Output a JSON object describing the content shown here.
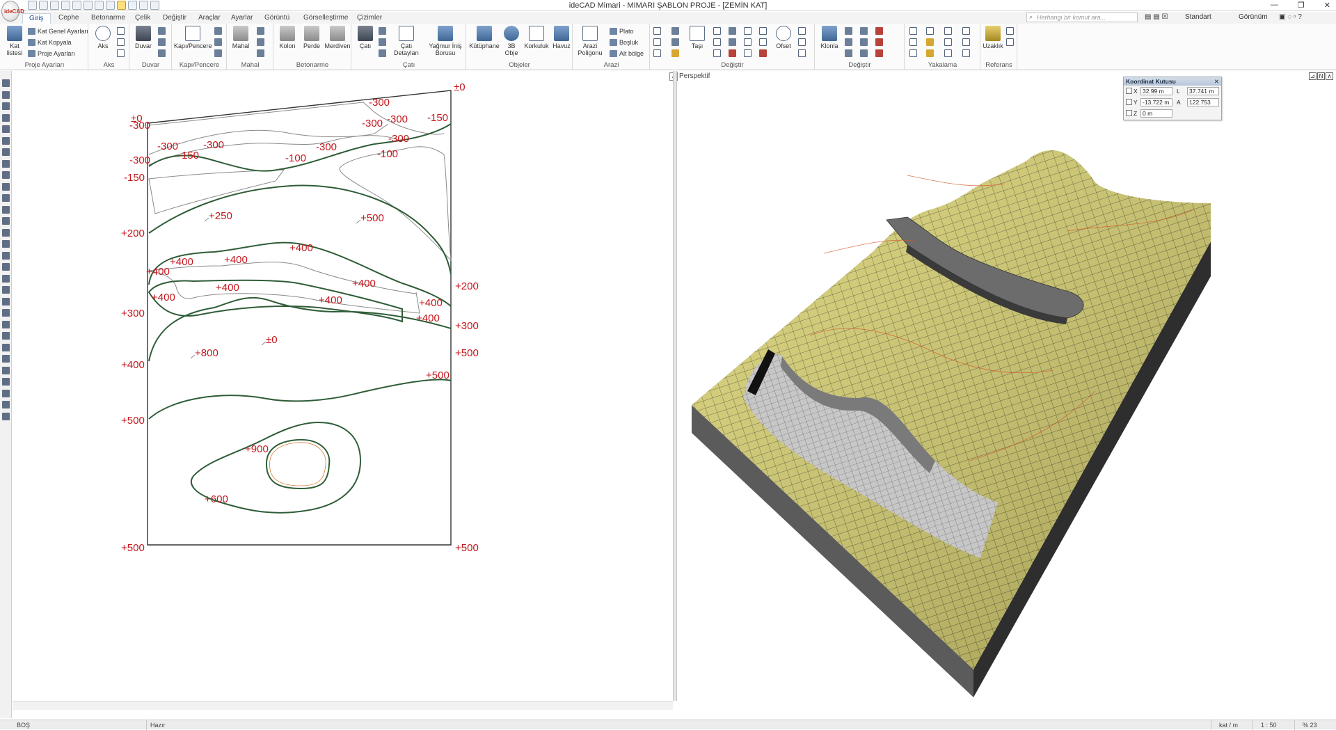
{
  "window": {
    "title": "ideCAD Mimari - MIMARI ŞABLON PROJE - [ZEMİN KAT]",
    "logo_text": "ideCAD",
    "controls": [
      "—",
      "❐",
      "✕"
    ]
  },
  "tabs": [
    "Giriş",
    "Cephe",
    "Betonarme",
    "Çelik",
    "Değiştir",
    "Araçlar",
    "Ayarlar",
    "Görüntü",
    "Görselleştirme",
    "Çizimler"
  ],
  "search": {
    "placeholder": "Herhangi bir komut ara..."
  },
  "topright": {
    "style": "Standart",
    "view": "Görünüm"
  },
  "ribbon": {
    "proje": {
      "label": "Proje Ayarları",
      "kat_listesi": "Kat listesi",
      "items": [
        "Kat Genel Ayarları",
        "Kat Kopyala",
        "Proje Ayarları"
      ]
    },
    "aks": {
      "label": "Aks",
      "btn": "Aks"
    },
    "duvar": {
      "label": "Duvar",
      "btn": "Duvar"
    },
    "kapi": {
      "label": "Kapı/Pencere",
      "btn": "Kapı/Pencere"
    },
    "mahal": {
      "label": "Mahal",
      "btn": "Mahal"
    },
    "betonarme": {
      "label": "Betonarme",
      "btns": [
        "Kolon",
        "Perde",
        "Merdiven"
      ]
    },
    "cati": {
      "label": "Çatı",
      "btns": [
        "Çatı",
        "Çatı Detayları",
        "Yağmur İniş Borusu"
      ]
    },
    "objeler": {
      "label": "Objeler",
      "btns": [
        "Kütüphane",
        "3B Obje",
        "Korkuluk",
        "Havuz"
      ]
    },
    "arazi": {
      "label": "Arazi",
      "btn": "Arazi Poligonu",
      "items": [
        "Plato",
        "Boşluk",
        "Alt bölge"
      ]
    },
    "degistir1": {
      "label": "Değiştir",
      "btns": [
        "Taşı",
        "Ofset"
      ]
    },
    "degistir2": {
      "label": "Değiştir",
      "btn": "Klonla"
    },
    "yakalama": {
      "label": "Yakalama"
    },
    "referans": {
      "label": "Referans",
      "btn": "Uzaklık"
    }
  },
  "plan": {
    "labels": [
      "±0",
      "±0",
      "-300",
      "-300",
      "-300",
      "-300",
      "-300",
      "-300",
      "-150",
      "-300",
      "-150",
      "-300",
      "-300",
      "-100",
      "-100",
      "-150",
      "+250",
      "+500",
      "+200",
      "+400",
      "+400",
      "+400",
      "+400",
      "+400",
      "+400",
      "+400",
      "+400",
      "+400",
      "+200",
      "+300",
      "+300",
      "+400",
      "±0",
      "+800",
      "+400",
      "+500",
      "+500",
      "+900",
      "+600",
      "+500",
      "+500"
    ]
  },
  "perspective": {
    "label": "Perspektif",
    "controls": [
      "⊿",
      "N",
      "∧"
    ]
  },
  "coord": {
    "title": "Koordinat Kutusu",
    "x_label": "X",
    "x": "32.99 m",
    "l_label": "L",
    "l": "37.741 m",
    "y_label": "Y",
    "y": "-13.722 m",
    "a_label": "A",
    "a": "122.753",
    "z_label": "Z",
    "z": "0 m"
  },
  "status": {
    "left": "BOŞ",
    "msg": "Hazır",
    "r1": "kat / m",
    "r2": "1 : 50",
    "r3": "% 23"
  }
}
